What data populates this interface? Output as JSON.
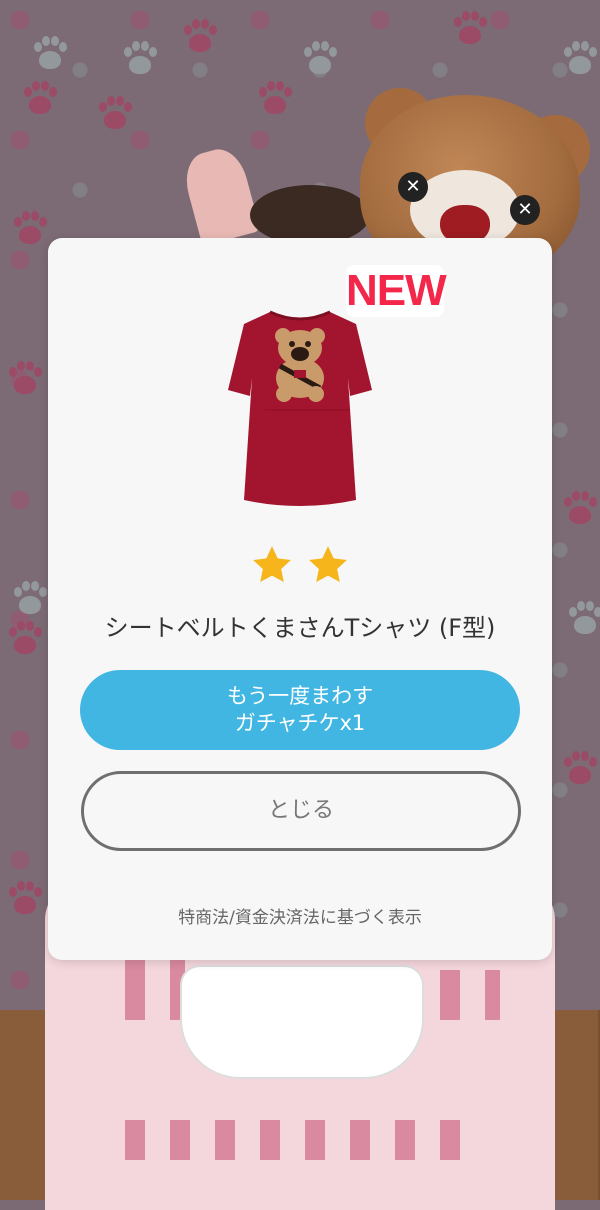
{
  "modal": {
    "new_badge": "NEW",
    "rarity_stars": 2,
    "item_name": "シートベルトくまさんTシャツ (F型)",
    "spin_again_button": {
      "line1": "もう一度まわす",
      "line2": "ガチャチケx1"
    },
    "close_button": "とじる",
    "legal_link": "特商法/資金決済法に基づく表示"
  },
  "colors": {
    "spin_button": "#41b6e2",
    "new_badge": "#f2274a",
    "star": "#f6b51a",
    "shirt": "#a3152e"
  },
  "icons": {
    "item": "red-teddy-bear-tshirt",
    "rarity": "star-icon"
  }
}
